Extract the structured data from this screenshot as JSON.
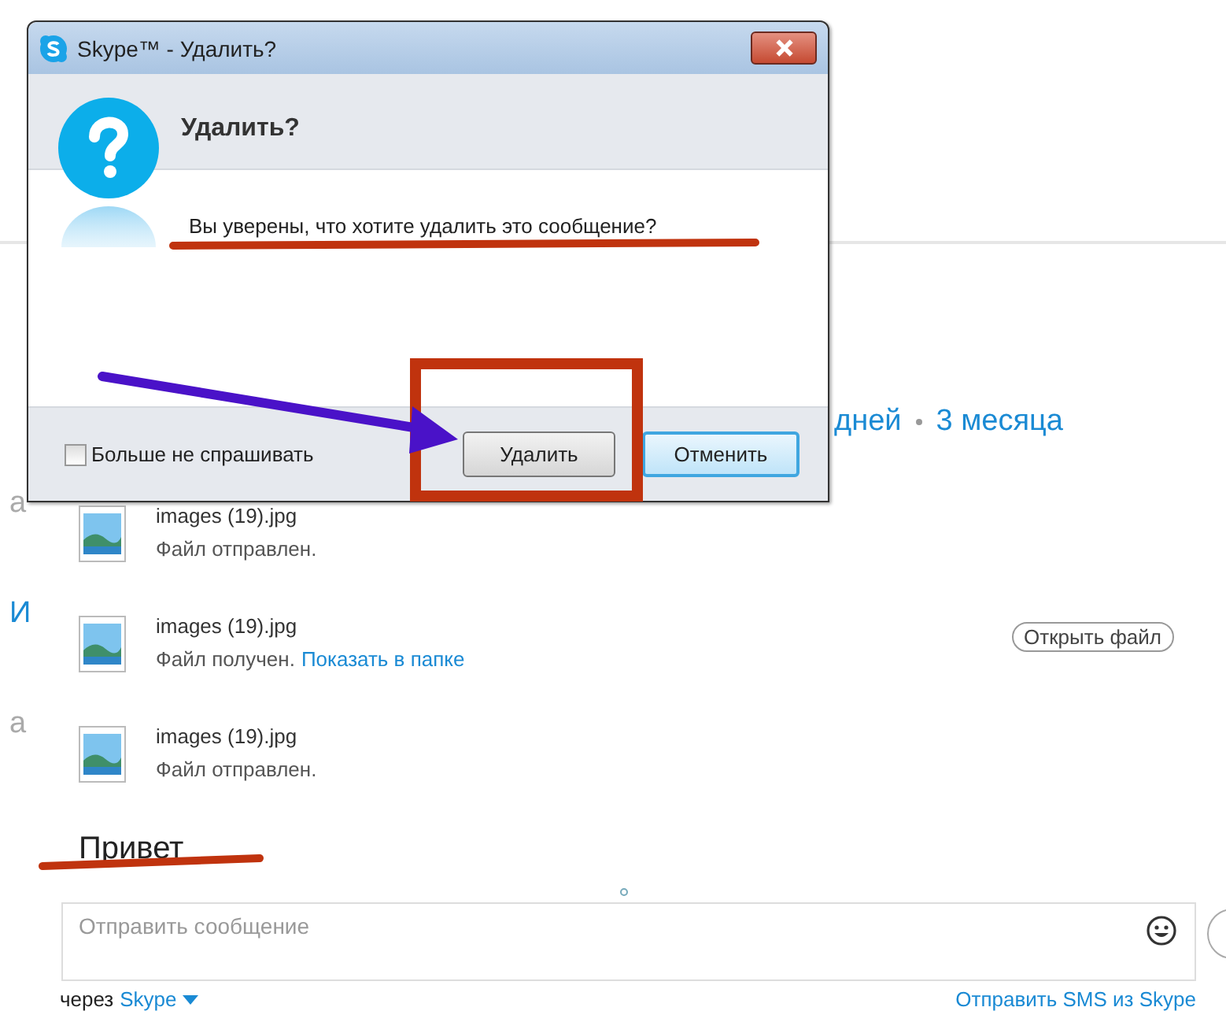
{
  "dialog": {
    "title": "Skype™ - Удалить?",
    "heading": "Удалить?",
    "message": "Вы уверены, что хотите удалить это сообщение?",
    "dont_ask": {
      "label": "Больше не спрашивать",
      "checked": false
    },
    "buttons": [
      {
        "label": "Удалить",
        "kind": "default"
      },
      {
        "label": "Отменить",
        "kind": "focused"
      }
    ]
  },
  "history_periods": [
    {
      "label": "дней"
    },
    {
      "label": "3 месяца"
    }
  ],
  "messages": [
    {
      "sender": "а",
      "color": "#aaaaaa",
      "file": "images (19).jpg",
      "status": "Файл отправлен."
    },
    {
      "sender": "И",
      "color": "#1a8ad4",
      "file": "images (19).jpg",
      "status": "Файл получен.",
      "link": "Показать в папке",
      "action": "Открыть файл"
    },
    {
      "sender": "а",
      "color": "#aaaaaa",
      "file": "images (19).jpg",
      "status": "Файл отправлен."
    }
  ],
  "last_message": "Привет",
  "composer": {
    "placeholder": "Отправить сообщение"
  },
  "footer": {
    "via": "через",
    "service": "Skype",
    "sms_link": "Отправить SMS из Skype"
  }
}
